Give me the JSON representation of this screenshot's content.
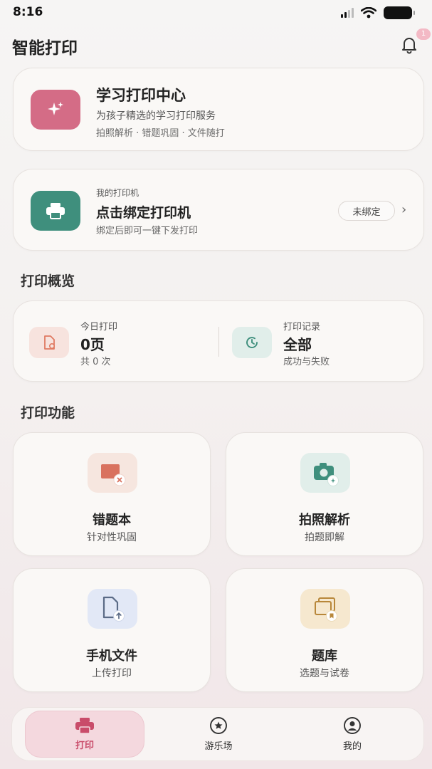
{
  "status_bar": {
    "time": "8:16"
  },
  "header": {
    "title": "智能打印",
    "notification_badge": "1"
  },
  "hero": {
    "title": "学习打印中心",
    "subtitle": "为孩子精选的学习打印服务",
    "tags": "拍照解析 · 错题巩固 · 文件随打",
    "icon": "sparkle-icon",
    "color": "#d46c86"
  },
  "printer": {
    "label": "我的打印机",
    "title": "点击绑定打印机",
    "subtitle": "绑定后即可一键下发打印",
    "status": "未绑定",
    "icon": "printer-icon",
    "color": "#3f8f7d"
  },
  "overview": {
    "title": "打印概览",
    "today": {
      "label": "今日打印",
      "value": "0页",
      "sub": "共 0 次",
      "icon": "document-icon"
    },
    "records": {
      "label": "打印记录",
      "value": "全部",
      "sub": "成功与失败",
      "icon": "history-icon"
    }
  },
  "features": {
    "title": "打印功能",
    "items": [
      {
        "title": "错题本",
        "subtitle": "针对性巩固",
        "icon": "wrong-question-icon"
      },
      {
        "title": "拍照解析",
        "subtitle": "拍题即解",
        "icon": "camera-icon"
      },
      {
        "title": "手机文件",
        "subtitle": "上传打印",
        "icon": "file-upload-icon"
      },
      {
        "title": "题库",
        "subtitle": "选题与试卷",
        "icon": "question-bank-icon"
      }
    ]
  },
  "tabbar": {
    "items": [
      {
        "label": "打印",
        "icon": "printer-icon",
        "active": true
      },
      {
        "label": "游乐场",
        "icon": "star-icon",
        "active": false
      },
      {
        "label": "我的",
        "icon": "user-icon",
        "active": false
      }
    ]
  },
  "colors": {
    "accent": "#c94c6a",
    "teal": "#3f8f7d"
  }
}
